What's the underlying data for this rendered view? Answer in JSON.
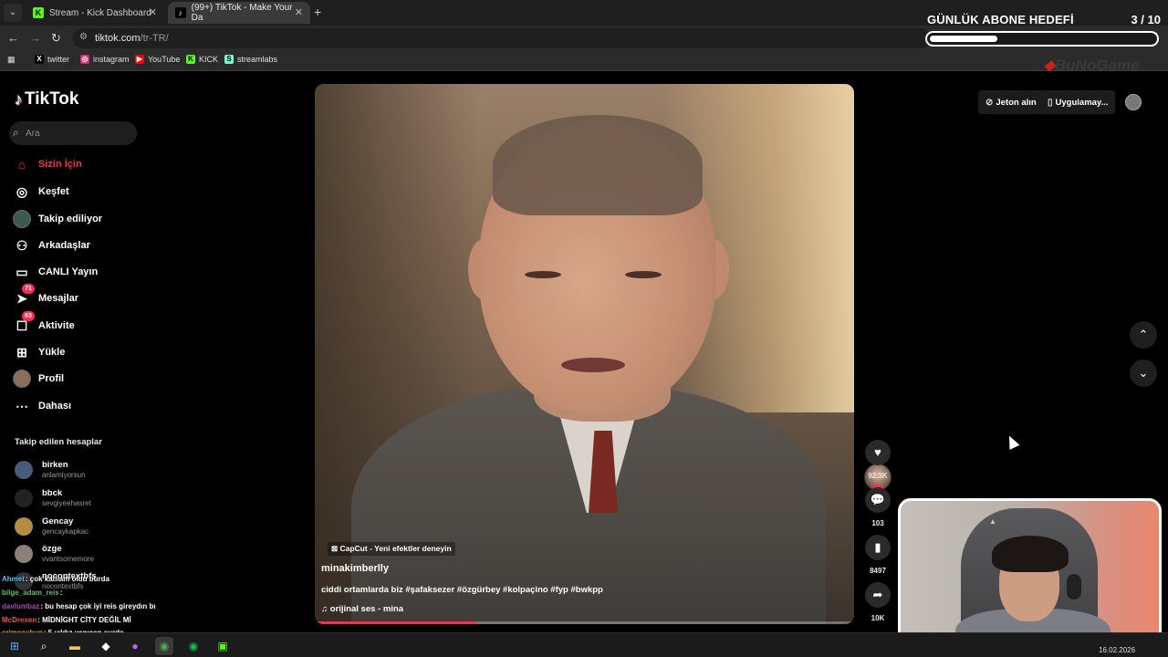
{
  "browser": {
    "tabs": [
      {
        "title": "Stream - Kick Dashboard",
        "icon": "kick-icon"
      },
      {
        "title": "(99+) TikTok - Make Your Da",
        "icon": "tiktok-icon"
      }
    ],
    "url_host": "tiktok.com",
    "url_path": "/tr-TR/",
    "bookmarks": [
      "twitter",
      "instagram",
      "YouTube",
      "KICK",
      "streamlabs"
    ]
  },
  "overlay": {
    "goal_title": "GÜNLÜK ABONE HEDEFİ",
    "goal_count": "3  / 10",
    "goal_progress": 0.3,
    "brand": "BuNoGame"
  },
  "sidebar": {
    "logo": "TikTok",
    "search_placeholder": "Ara",
    "nav": [
      {
        "label": "Sizin İçin",
        "icon": "home-icon",
        "active": true
      },
      {
        "label": "Keşfet",
        "icon": "compass-icon"
      },
      {
        "label": "Takip ediliyor",
        "icon": "following-avatar-icon"
      },
      {
        "label": "Arkadaşlar",
        "icon": "friends-icon"
      },
      {
        "label": "CANLI Yayın",
        "icon": "live-icon"
      },
      {
        "label": "Mesajlar",
        "icon": "messages-icon",
        "badge": "71"
      },
      {
        "label": "Aktivite",
        "icon": "activity-icon",
        "badge": "63"
      },
      {
        "label": "Yükle",
        "icon": "upload-icon"
      },
      {
        "label": "Profil",
        "icon": "profile-icon"
      },
      {
        "label": "Dahası",
        "icon": "more-icon"
      }
    ],
    "following_title": "Takip edilen hesaplar",
    "following": [
      {
        "name": "birken",
        "handle": "anlamiyorsun"
      },
      {
        "name": "bbck",
        "handle": "sevgiyeehasret"
      },
      {
        "name": "Gencay",
        "handle": "gencaykapkac"
      },
      {
        "name": "özge",
        "handle": "vvantsomemore"
      },
      {
        "name": "nocontextbfs",
        "handle": "nocontextbfs"
      }
    ]
  },
  "chat": [
    {
      "user": "Ahmet",
      "msg": ": çok katliam oldu burda",
      "color": "#4fc3f7"
    },
    {
      "user": "bilge_adam_reis",
      "msg": ":",
      "color": "#66bb6a"
    },
    {
      "user": "davlumbaz",
      "msg": ": bu hesap çok iyi reis gireydın bı",
      "color": "#ab47bc"
    },
    {
      "user": "McDrexen",
      "msg": ": MİDNİGHT CİTY DEĞİL Mİ",
      "color": "#ef5350"
    },
    {
      "user": "erimcoskun",
      "msg": ": 5 yıldız yapıcan surda",
      "color": "#ffa726"
    }
  ],
  "video": {
    "effect": "CapCut - Yeni efektler deneyin",
    "username": "minakimberlly",
    "description": "ciddi ortamlarda biz #şafaksezer #özgürbey #kolpaçino #fyp #bwkpp",
    "music": "orijinal ses - mina",
    "progress": 0.3
  },
  "actions": {
    "likes": "92.3K",
    "comments": "103",
    "saves": "8497",
    "shares": "10K"
  },
  "topbar": {
    "coins": "Jeton alın",
    "app": "Uygulamay..."
  },
  "taskbar": {
    "date": "16.02.2026"
  }
}
